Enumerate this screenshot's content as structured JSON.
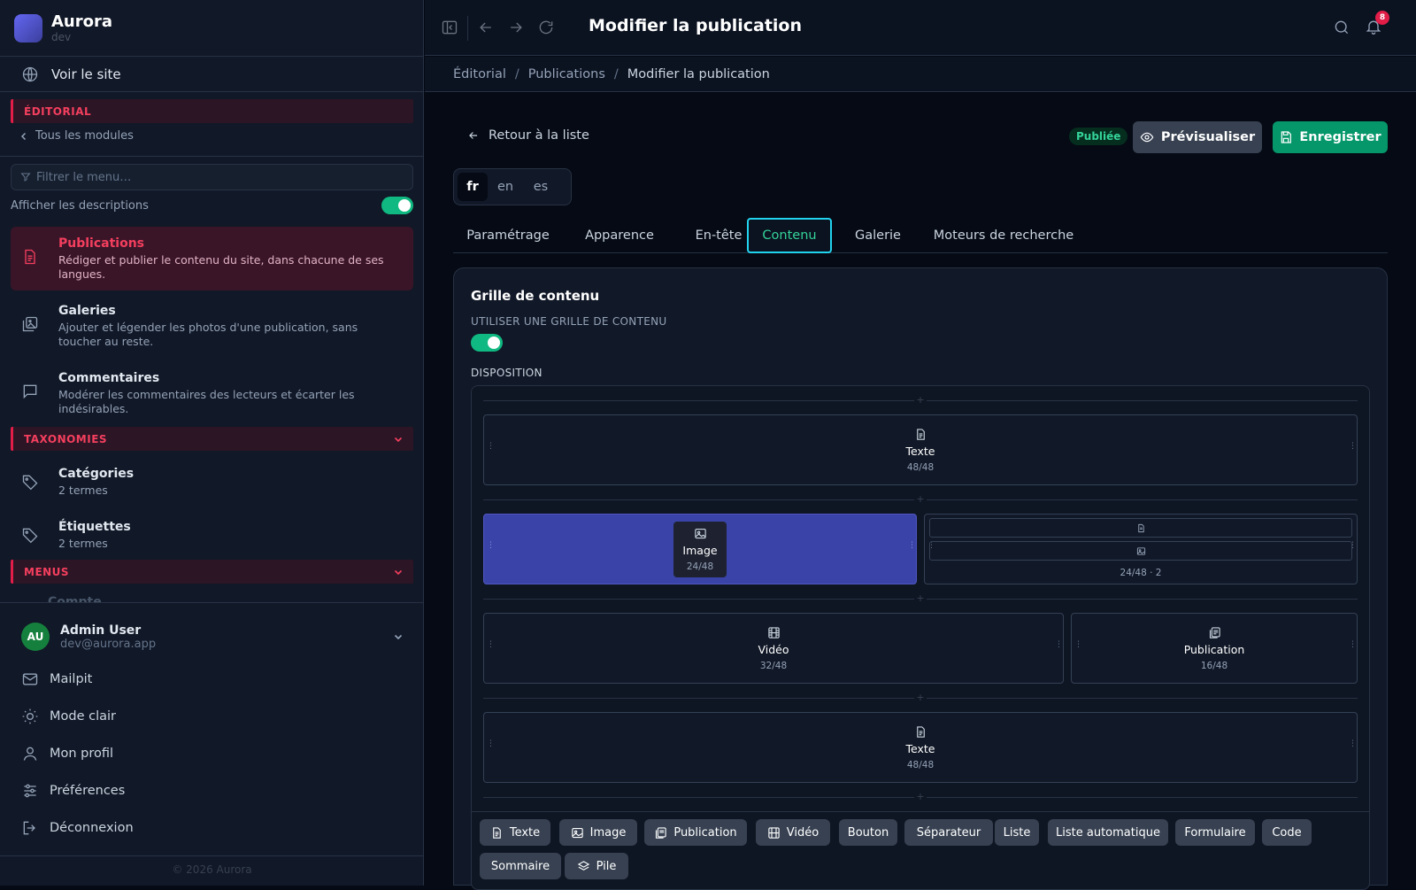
{
  "app": {
    "name": "Aurora",
    "env": "dev"
  },
  "sidebar": {
    "view_site": "Voir le site",
    "section_editorial": "ÉDITORIAL",
    "all_modules": "Tous les modules",
    "filter_placeholder": "Filtrer le menu…",
    "show_descriptions": "Afficher les descriptions",
    "show_descriptions_on": true,
    "items": [
      {
        "title": "Publications",
        "desc": "Rédiger et publier le contenu du site, dans chacune de ses langues.",
        "icon": "document-icon",
        "active": true
      },
      {
        "title": "Galeries",
        "desc": "Ajouter et légender les photos d'une publication, sans toucher au reste.",
        "icon": "gallery-icon"
      },
      {
        "title": "Commentaires",
        "desc": "Modérer les commentaires des lecteurs et écarter les indésirables.",
        "icon": "comment-icon"
      }
    ],
    "section_taxonomies": "TAXONOMIES",
    "taxonomies": [
      {
        "title": "Catégories",
        "desc": "2 termes",
        "icon": "tag-icon"
      },
      {
        "title": "Étiquettes",
        "desc": "2 termes",
        "icon": "tag-icon"
      }
    ],
    "section_menus": "MENUS",
    "menus_peek": "Compte",
    "user": {
      "initials": "AU",
      "name": "Admin User",
      "email": "dev@aurora.app"
    },
    "footer": [
      {
        "label": "Mailpit",
        "icon": "mail-icon"
      },
      {
        "label": "Mode clair",
        "icon": "sun-icon"
      },
      {
        "label": "Mon profil",
        "icon": "user-icon"
      },
      {
        "label": "Préférences",
        "icon": "sliders-icon"
      },
      {
        "label": "Déconnexion",
        "icon": "logout-icon"
      }
    ],
    "copyright": "© 2026 Aurora"
  },
  "topbar": {
    "title": "Modifier la publication",
    "notifications": "8"
  },
  "breadcrumb": [
    "Éditorial",
    "Publications",
    "Modifier la publication"
  ],
  "main": {
    "back": "Retour à la liste",
    "status": "Publiée",
    "preview": "Prévisualiser",
    "save": "Enregistrer",
    "languages": [
      "fr",
      "en",
      "es"
    ],
    "active_language": "fr",
    "tabs": [
      "Paramétrage",
      "Apparence",
      "En-tête",
      "Contenu",
      "Galerie",
      "Moteurs de recherche"
    ],
    "active_tab": "Contenu",
    "card_title": "Grille de contenu",
    "use_grid_label": "UTILISER UNE GRILLE DE CONTENU",
    "use_grid_on": true,
    "layout_label": "DISPOSITION",
    "blocks": [
      {
        "name": "Texte",
        "size": "48/48",
        "icon": "document-icon"
      },
      {
        "name": "Image",
        "size": "24/48",
        "icon": "image-icon",
        "selected": true
      },
      {
        "name": "",
        "size": "24/48 · 2",
        "icon": "stack-icon"
      },
      {
        "name": "Vidéo",
        "size": "32/48",
        "icon": "film-icon"
      },
      {
        "name": "Publication",
        "size": "16/48",
        "icon": "publication-icon"
      },
      {
        "name": "Texte",
        "size": "48/48",
        "icon": "document-icon"
      }
    ],
    "palette": [
      {
        "label": "Texte",
        "icon": "document-icon"
      },
      {
        "label": "Image",
        "icon": "image-icon"
      },
      {
        "label": "Publication",
        "icon": "publication-icon"
      },
      {
        "label": "Vidéo",
        "icon": "film-icon"
      },
      {
        "label": "Bouton"
      },
      {
        "label": "Séparateur"
      },
      {
        "label": "Liste"
      },
      {
        "label": "Liste automatique"
      },
      {
        "label": "Formulaire"
      },
      {
        "label": "Code"
      },
      {
        "label": "Sommaire"
      },
      {
        "label": "Pile",
        "icon": "layers-icon"
      }
    ]
  },
  "colors": {
    "accent": "#e11d48",
    "success": "#059669",
    "selection": "#3a44a8",
    "focus": "#22d3ee"
  }
}
